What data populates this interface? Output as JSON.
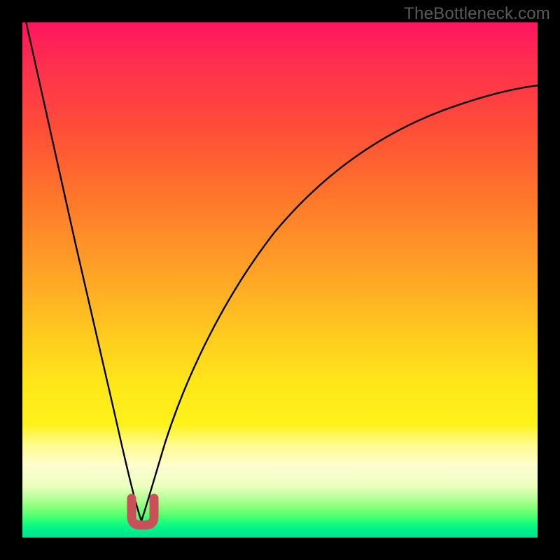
{
  "watermark": {
    "text": "TheBottleneck.com"
  },
  "colors": {
    "curve_stroke": "#000000",
    "marker_stroke": "#c94f59",
    "gradient_stops": [
      "#ff1461",
      "#ff2f4e",
      "#ff5136",
      "#ff7a2a",
      "#ffa126",
      "#ffc81f",
      "#ffe61a",
      "#fff21a",
      "#fffb8d",
      "#fffccf",
      "#ecffc0",
      "#a6ff8a",
      "#5dff6e",
      "#1bff7a",
      "#00f08a",
      "#00e28e"
    ]
  },
  "chart_data": {
    "type": "line",
    "title": "",
    "xlabel": "",
    "ylabel": "",
    "x_range": [
      0,
      100
    ],
    "y_range": [
      0,
      100
    ],
    "note": "No axes or tick labels are rendered; values are estimated positions in percent of the visible plot area (0,0 = bottom-left). The curve plunges from top-left to a minimum near x≈23 and rises toward the upper-right.",
    "series": [
      {
        "name": "bottleneck-curve",
        "x": [
          0,
          3,
          6,
          9,
          12,
          15,
          18,
          20,
          22,
          23,
          24,
          26,
          28,
          31,
          35,
          40,
          46,
          53,
          61,
          70,
          80,
          90,
          100
        ],
        "y": [
          100,
          88,
          76,
          64,
          52,
          40,
          28,
          18,
          10,
          5,
          6,
          10,
          18,
          28,
          38,
          48,
          57,
          65,
          72,
          77,
          81,
          84,
          86
        ]
      }
    ],
    "highlight": {
      "name": "minimum-marker-U",
      "description": "Small rounded U-shaped pink marker straddling the curve minimum",
      "x_range": [
        21.2,
        25.0
      ],
      "y_range": [
        3.5,
        8.0
      ]
    }
  }
}
